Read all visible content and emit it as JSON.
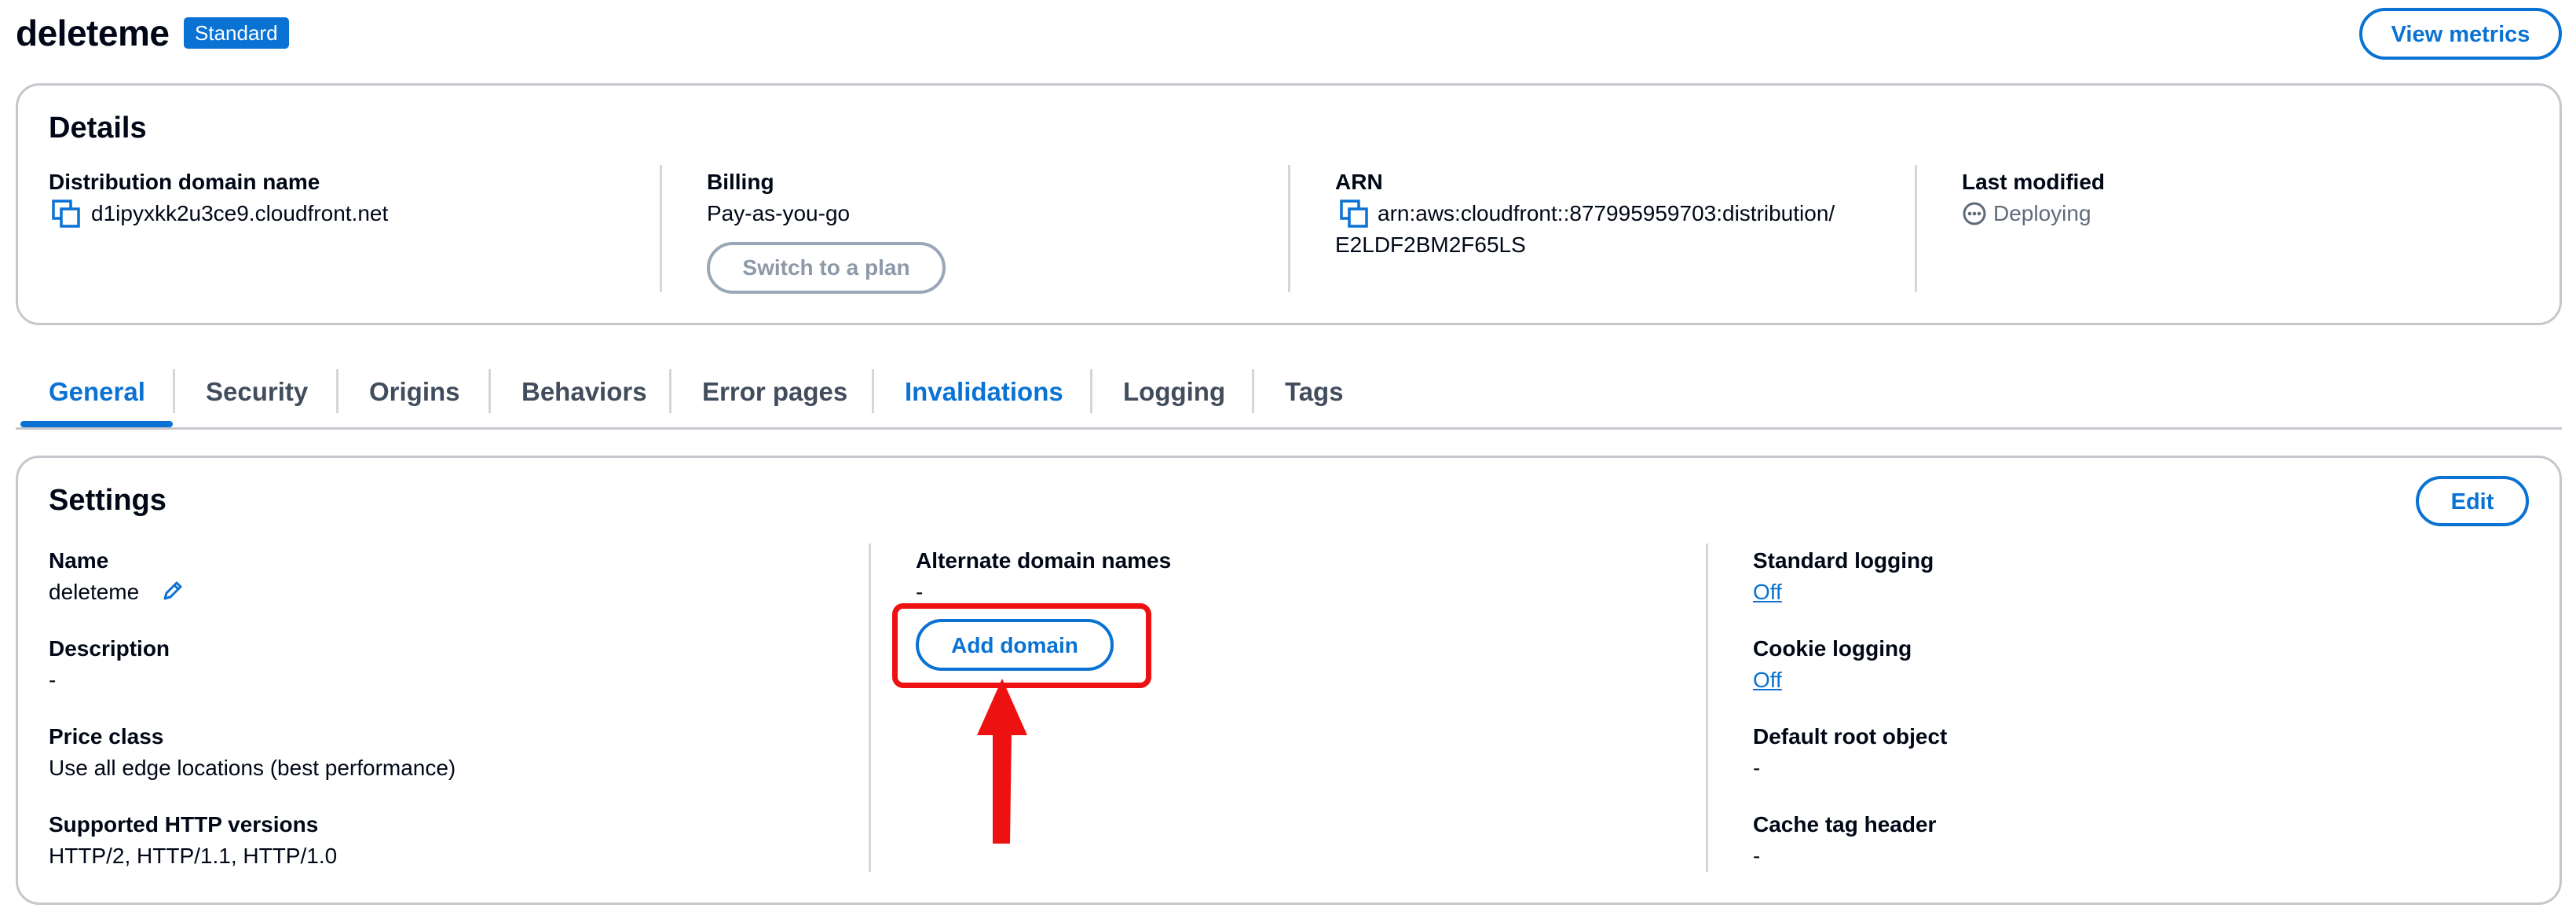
{
  "header": {
    "title": "deleteme",
    "badge": "Standard",
    "view_metrics_label": "View metrics"
  },
  "details": {
    "title": "Details",
    "domain": {
      "label": "Distribution domain name",
      "value": "d1ipyxkk2u3ce9.cloudfront.net"
    },
    "billing": {
      "label": "Billing",
      "value": "Pay-as-you-go",
      "button": "Switch to a plan"
    },
    "arn": {
      "label": "ARN",
      "line1": "arn:aws:cloudfront::877995959703:distribution/",
      "line2": "E2LDF2BM2F65LS"
    },
    "last_modified": {
      "label": "Last modified",
      "value": "Deploying"
    }
  },
  "tabs": [
    "General",
    "Security",
    "Origins",
    "Behaviors",
    "Error pages",
    "Invalidations",
    "Logging",
    "Tags"
  ],
  "settings": {
    "title": "Settings",
    "edit_label": "Edit",
    "name": {
      "label": "Name",
      "value": "deleteme"
    },
    "description": {
      "label": "Description",
      "value": "-"
    },
    "price_class": {
      "label": "Price class",
      "value": "Use all edge locations (best performance)"
    },
    "http_versions": {
      "label": "Supported HTTP versions",
      "value": "HTTP/2, HTTP/1.1, HTTP/1.0"
    },
    "alt_domains": {
      "label": "Alternate domain names",
      "value": "-",
      "button": "Add domain"
    },
    "standard_logging": {
      "label": "Standard logging",
      "value": "Off"
    },
    "cookie_logging": {
      "label": "Cookie logging",
      "value": "Off"
    },
    "default_root": {
      "label": "Default root object",
      "value": "-"
    },
    "cache_tag": {
      "label": "Cache tag header",
      "value": "-"
    }
  },
  "colors": {
    "accent": "#0972d3",
    "annotation": "#ee1111",
    "text": "#000716"
  },
  "icons": [
    "copy-icon",
    "pencil-icon",
    "status-in-progress-icon",
    "arrow-annotation-icon"
  ]
}
